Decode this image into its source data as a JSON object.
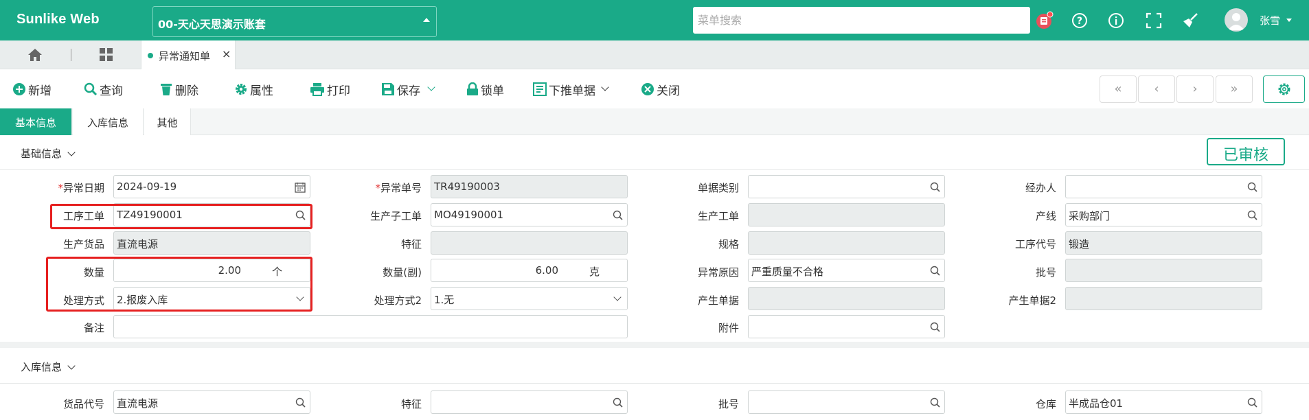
{
  "app": {
    "logo": "Sunlike Web",
    "account": "00-天心天思演示账套"
  },
  "header": {
    "search_placeholder": "菜单搜索",
    "user_name": "张雪"
  },
  "tabs": {
    "doc_tab": "异常通知单",
    "close": "×"
  },
  "toolbar": {
    "new": "新增",
    "query": "查询",
    "delete": "删除",
    "property": "属性",
    "print": "打印",
    "save": "保存",
    "lock": "锁单",
    "push_down": "下推单据",
    "close": "关闭",
    "nav_first": "«",
    "nav_prev": "‹",
    "nav_next": "›",
    "nav_last": "»"
  },
  "form_tabs": [
    "基本信息",
    "入库信息",
    "其他"
  ],
  "status_stamp": "已审核",
  "colors": {
    "brand": "#1aaa88",
    "highlight": "#e62020",
    "required": "#e03030"
  },
  "basic": {
    "title": "基础信息",
    "exception_date": {
      "label": "异常日期",
      "value": "2024-09-19"
    },
    "exception_no": {
      "label": "异常单号",
      "value": "TR49190003"
    },
    "doc_category": {
      "label": "单据类别",
      "value": ""
    },
    "handler": {
      "label": "经办人",
      "value": ""
    },
    "process_order": {
      "label": "工序工单",
      "value": "TZ49190001"
    },
    "prod_sub_order": {
      "label": "生产子工单",
      "value": "MO49190001"
    },
    "prod_order": {
      "label": "生产工单",
      "value": ""
    },
    "prod_line": {
      "label": "产线",
      "value": "采购部门"
    },
    "prod_goods": {
      "label": "生产货品",
      "value": "直流电源"
    },
    "feature": {
      "label": "特征",
      "value": ""
    },
    "spec": {
      "label": "规格",
      "value": ""
    },
    "process_code": {
      "label": "工序代号",
      "value": "锻造"
    },
    "qty": {
      "label": "数量",
      "value": "2.00",
      "unit": "个"
    },
    "qty_sub": {
      "label": "数量(副)",
      "value": "6.00",
      "unit": "克"
    },
    "exception_reason": {
      "label": "异常原因",
      "value": "严重质量不合格"
    },
    "batch_no": {
      "label": "批号",
      "value": ""
    },
    "handling": {
      "label": "处理方式",
      "value": "2.报废入库"
    },
    "handling2": {
      "label": "处理方式2",
      "value": "1.无"
    },
    "gen_doc": {
      "label": "产生单据",
      "value": ""
    },
    "gen_doc2": {
      "label": "产生单据2",
      "value": ""
    },
    "remark": {
      "label": "备注",
      "value": ""
    },
    "attachment": {
      "label": "附件",
      "value": ""
    }
  },
  "storage": {
    "title": "入库信息",
    "goods_code": {
      "label": "货品代号",
      "value": "直流电源"
    },
    "feature": {
      "label": "特征",
      "value": ""
    },
    "batch_no": {
      "label": "批号",
      "value": ""
    },
    "warehouse": {
      "label": "仓库",
      "value": "半成品仓01"
    }
  }
}
